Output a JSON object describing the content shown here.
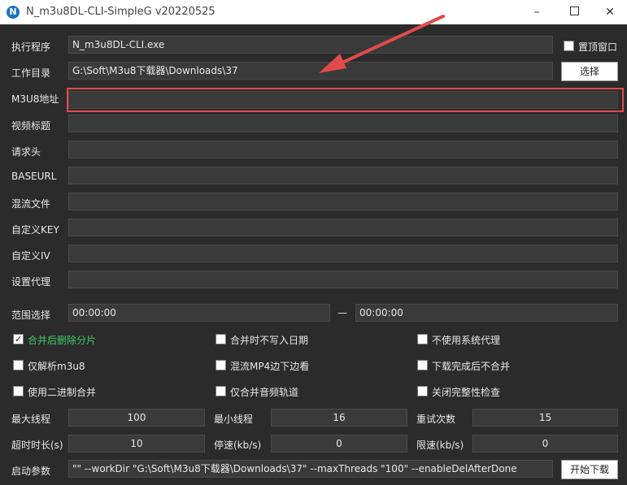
{
  "window": {
    "icon_letter": "N",
    "title": "N_m3u8DL-CLI-SimpleG v20220525",
    "minimize": "–",
    "close": "✕"
  },
  "form": {
    "exe": {
      "label": "执行程序",
      "value": "N_m3u8DL-CLI.exe"
    },
    "pin_window": {
      "label": "置顶窗口",
      "checked": false
    },
    "workdir": {
      "label": "工作目录",
      "value": "G:\\Soft\\M3u8下载器\\Downloads\\37"
    },
    "choose_button": "选择",
    "m3u8_url": {
      "label": "M3U8地址",
      "value": ""
    },
    "video_title": {
      "label": "视频标题",
      "value": ""
    },
    "headers": {
      "label": "请求头",
      "value": ""
    },
    "baseurl": {
      "label": "BASEURL",
      "value": ""
    },
    "mux_file": {
      "label": "混流文件",
      "value": ""
    },
    "custom_key": {
      "label": "自定义KEY",
      "value": ""
    },
    "custom_iv": {
      "label": "自定义IV",
      "value": ""
    },
    "proxy": {
      "label": "设置代理",
      "value": ""
    },
    "range": {
      "label": "范围选择",
      "start": "00:00:00",
      "separator": "—",
      "end": "00:00:00"
    }
  },
  "options": [
    {
      "label": "合并后删除分片",
      "checked": true
    },
    {
      "label": "合并时不写入日期",
      "checked": false
    },
    {
      "label": "不使用系统代理",
      "checked": false
    },
    {
      "label": "仅解析m3u8",
      "checked": false
    },
    {
      "label": "混流MP4边下边看",
      "checked": false
    },
    {
      "label": "下载完成后不合并",
      "checked": false
    },
    {
      "label": "使用二进制合并",
      "checked": false
    },
    {
      "label": "仅合并音频轨道",
      "checked": false
    },
    {
      "label": "关闭完整性检查",
      "checked": false
    }
  ],
  "params": {
    "max_threads": {
      "label": "最大线程",
      "value": "100"
    },
    "min_threads": {
      "label": "最小线程",
      "value": "16"
    },
    "retry": {
      "label": "重试次数",
      "value": "15"
    },
    "timeout": {
      "label": "超时时长(s)",
      "value": "10"
    },
    "stop_speed": {
      "label": "停速(kb/s)",
      "value": "0"
    },
    "limit_speed": {
      "label": "限速(kb/s)",
      "value": "0"
    }
  },
  "launch": {
    "label": "启动参数",
    "value": "\"\" --workDir \"G:\\Soft\\M3u8下载器\\Downloads\\37\" --maxThreads \"100\" --enableDelAfterDone",
    "start_button": "开始下载"
  },
  "colors": {
    "background": "#2b2b2b",
    "field": "#3a3a3a",
    "highlight": "#e14b4b",
    "checked_label": "#3fca6b"
  }
}
